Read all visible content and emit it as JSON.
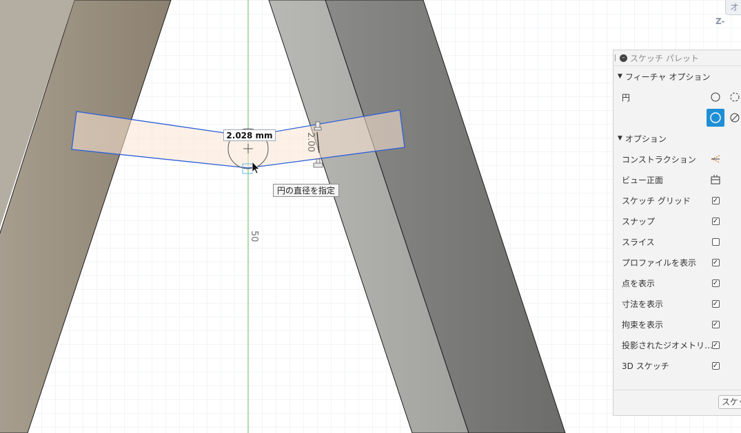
{
  "viewport": {
    "dimension_value": "2.028 mm",
    "tooltip": "円の直径を指定",
    "dim_200": "2.00",
    "dim_50": "50",
    "viewcube_label": "Z-",
    "viewcube_face": "オ"
  },
  "palette": {
    "title": "スケッチ パレット",
    "sections": {
      "feature_options": "フィーチャ オプション",
      "options": "オプション"
    },
    "circle_label": "円",
    "options": [
      {
        "label": "コンストラクション",
        "control": "construction-icon"
      },
      {
        "label": "ビュー正面",
        "control": "look-at-icon"
      },
      {
        "label": "スケッチ グリッド",
        "checked": true
      },
      {
        "label": "スナップ",
        "checked": true
      },
      {
        "label": "スライス",
        "checked": false
      },
      {
        "label": "プロファイルを表示",
        "checked": true
      },
      {
        "label": "点を表示",
        "checked": true
      },
      {
        "label": "寸法を表示",
        "checked": true
      },
      {
        "label": "拘束を表示",
        "checked": true
      },
      {
        "label": "投影されたジオメトリ…",
        "checked": true
      },
      {
        "label": "3D スケッチ",
        "checked": true
      }
    ],
    "finish_button": "スケッチ"
  },
  "colors": {
    "sketch_line": "#2b5fd9",
    "selected_blue": "#1e8fd5",
    "axis_green": "#7ac97a"
  }
}
